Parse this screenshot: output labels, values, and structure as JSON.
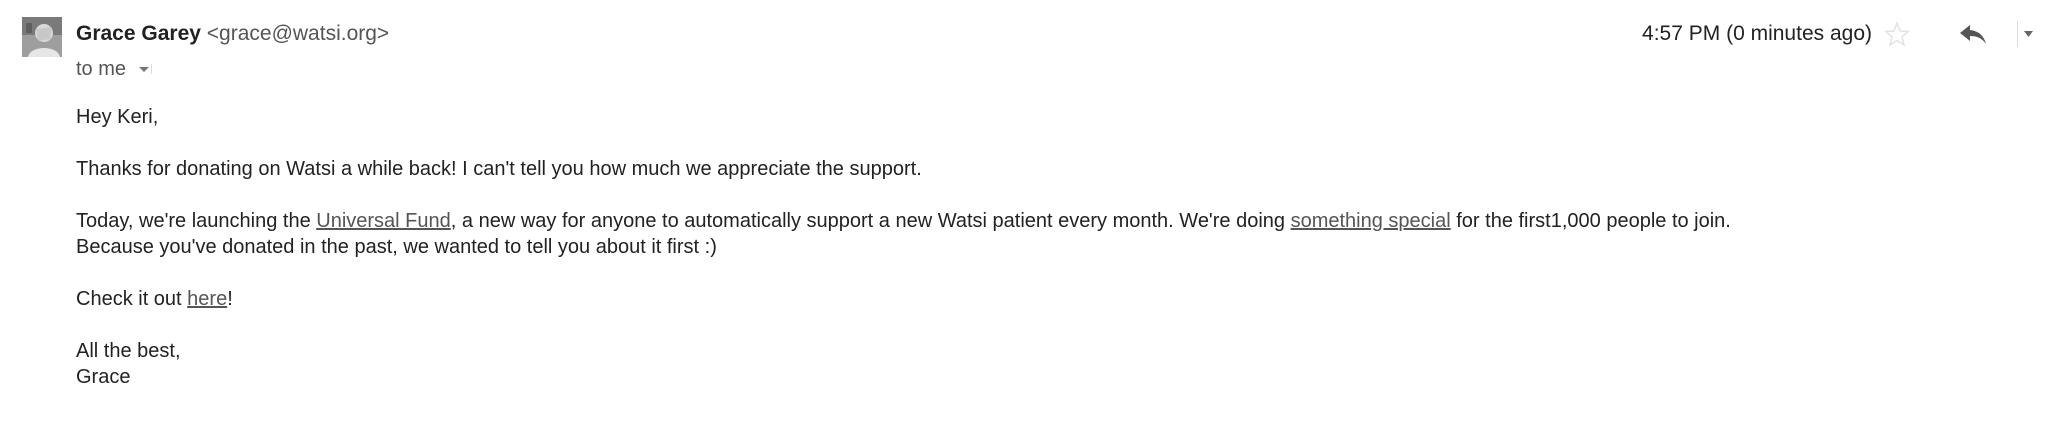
{
  "header": {
    "sender_name": "Grace Garey",
    "sender_email": "<grace@watsi.org>",
    "recipient": "to me",
    "timestamp": "4:57 PM (0 minutes ago)"
  },
  "icons": {
    "avatar": "profile-photo",
    "details": "chevron-down-icon",
    "star": "star-outline-icon",
    "reply": "reply-arrow-icon",
    "more": "chevron-down-icon"
  },
  "body": {
    "greeting": "Hey Keri,",
    "p1": "Thanks for donating on Watsi a while back! I can't tell you how much we appreciate the support.",
    "p2_before": "Today, we're launching the ",
    "p2_link1": "Universal Fund",
    "p2_middle": ", a new way for anyone to automatically support a new Watsi patient every month. We're doing ",
    "p2_link2": "something special",
    "p2_after": " for the first1,000 people to join.",
    "p2_line2": "Because you've donated in the past, we wanted to tell you about it first :)",
    "p3_before": "Check it out ",
    "p3_link": "here",
    "p3_after": "!",
    "signoff": "All the best,",
    "signature": "Grace"
  }
}
